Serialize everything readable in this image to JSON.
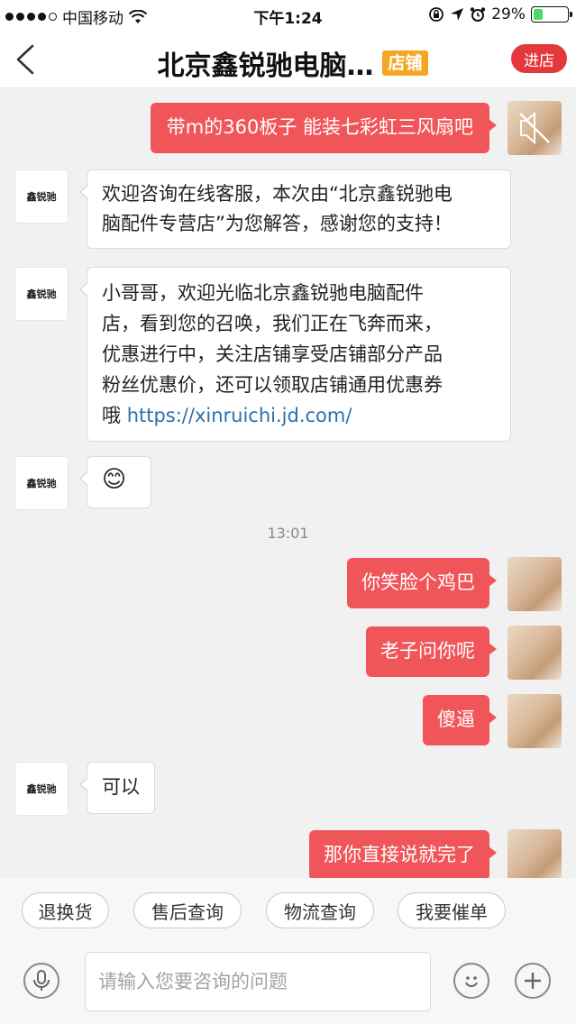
{
  "status_bar": {
    "carrier": "中国移动",
    "time": "下午1:24",
    "battery": "29%",
    "battery_level": 0.29
  },
  "header": {
    "title": "北京鑫锐驰电脑…",
    "badge": "店铺",
    "enter_label": "进店"
  },
  "messages": {
    "m1": {
      "from": "user",
      "text": "带m的360板子 能装七彩虹三风扇吧"
    },
    "m2": {
      "from": "shop",
      "text_line1": "欢迎咨询在线客服，本次由“北京鑫锐驰电",
      "text_line2": "脑配件专营店”为您解答，感谢您的支持！"
    },
    "m3": {
      "from": "shop",
      "line1": "小哥哥，欢迎光临北京鑫锐驰电脑配件",
      "line2": "店，看到您的召唤，我们正在飞奔而来，",
      "line3": "优惠进行中，关注店铺享受店铺部分产品",
      "line4": "粉丝优惠价，还可以领取店铺通用优惠券",
      "line5_prefix": "哦",
      "link": "https://xinruichi.jd.com/"
    },
    "m4": {
      "from": "shop",
      "emoji": "😊"
    },
    "time_divider": "13:01",
    "m5": {
      "from": "user",
      "text": "你笑脸个鸡巴"
    },
    "m6": {
      "from": "user",
      "text": "老子问你呢"
    },
    "m7": {
      "from": "user",
      "text": "傻逼"
    },
    "m8": {
      "from": "shop",
      "text": "可以"
    },
    "m9": {
      "from": "user",
      "text": "那你直接说就完了"
    }
  },
  "shop_avatar_text": "鑫锐驰",
  "quick_actions": [
    "退换货",
    "售后查询",
    "物流查询",
    "我要催单"
  ],
  "input": {
    "placeholder": "请输入您要咨询的问题"
  },
  "colors": {
    "accent": "#e4393c",
    "user_bubble": "#f0555a",
    "badge": "#f5a623",
    "link": "#2d6fa8"
  },
  "icons": [
    "back-chevron-icon",
    "mute-icon",
    "microphone-icon",
    "emoji-icon",
    "plus-icon"
  ]
}
